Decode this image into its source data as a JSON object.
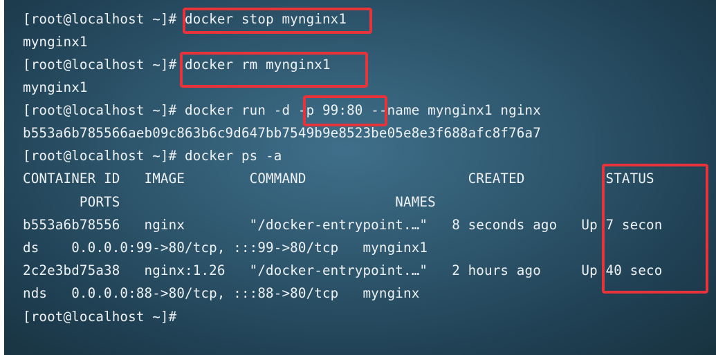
{
  "terminal": {
    "lines": [
      {
        "prompt": "[root@localhost ~]#",
        "text": " docker stop mynginx1"
      },
      {
        "prompt": "",
        "text": "mynginx1"
      },
      {
        "prompt": "[root@localhost ~]#",
        "text": " docker rm mynginx1"
      },
      {
        "prompt": "",
        "text": "mynginx1"
      },
      {
        "prompt": "[root@localhost ~]#",
        "text": " docker run -d -p 99:80 --name mynginx1 nginx"
      },
      {
        "prompt": "",
        "text": "b553a6b785566aeb09c863b6c9d647bb7549b9e8523be05e8e3f688afc8f76a7"
      },
      {
        "prompt": "[root@localhost ~]#",
        "text": " docker ps -a"
      },
      {
        "prompt": "",
        "text": "CONTAINER ID   IMAGE        COMMAND                    CREATED          STATUS"
      },
      {
        "prompt": "",
        "text": "       PORTS                                  NAMES"
      },
      {
        "prompt": "",
        "text": "b553a6b78556   nginx        \"/docker-entrypoint.…\"   8 seconds ago   Up 7 secon"
      },
      {
        "prompt": "",
        "text": "ds    0.0.0.0:99->80/tcp, :::99->80/tcp   mynginx1"
      },
      {
        "prompt": "",
        "text": "2c2e3bd75a38   nginx:1.26   \"/docker-entrypoint.…\"   2 hours ago     Up 40 seco"
      },
      {
        "prompt": "",
        "text": "nds   0.0.0.0:88->80/tcp, :::88->80/tcp   mynginx"
      },
      {
        "prompt": "[root@localhost ~]#",
        "text": ""
      }
    ]
  },
  "colors": {
    "text": "#eef2f5",
    "highlight_border": "#e8333a",
    "background_center": "#3f6f8a",
    "background_edge": "#18323f"
  }
}
